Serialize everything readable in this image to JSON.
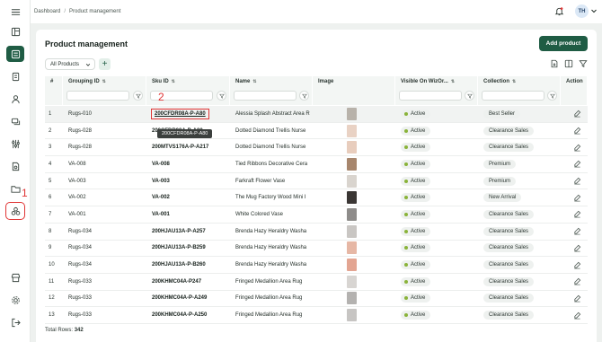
{
  "breadcrumb": {
    "home": "Dashboard",
    "separator": "/",
    "current": "Product management"
  },
  "user": {
    "initials": "TH"
  },
  "page": {
    "title": "Product management",
    "add_label": "Add product"
  },
  "filters": {
    "collection_selector": "All Products",
    "add_symbol": "+"
  },
  "columns": {
    "num": "#",
    "grouping": "Grouping ID",
    "sku": "Sku ID",
    "name": "Name",
    "image": "Image",
    "visible": "Visible On WizOr...",
    "collection": "Collection",
    "action": "Action"
  },
  "rows": [
    {
      "num": "1",
      "grouping": "Rugs-010",
      "sku": "200CFDR08A-P-A80",
      "name": "Alessia Splash Abstract Area R",
      "status": "Active",
      "collection": "Best Seller",
      "thumb": "#b8b2aa"
    },
    {
      "num": "2",
      "grouping": "Rugs-028",
      "sku": "200CFDR08A-P-A80",
      "name": "Dotted Diamond Trellis Nurse",
      "status": "Active",
      "collection": "Clearance Sales",
      "thumb": "#e9d2c4"
    },
    {
      "num": "3",
      "grouping": "Rugs-028",
      "sku": "200MTVS176A-P-A217",
      "name": "Dotted Diamond Trellis Nurse",
      "status": "Active",
      "collection": "Clearance Sales",
      "thumb": "#e8cdbd"
    },
    {
      "num": "4",
      "grouping": "VA-008",
      "sku": "VA-008",
      "name": "Tied Ribbons Decorative Cera",
      "status": "Active",
      "collection": "Premium",
      "thumb": "#a7866d"
    },
    {
      "num": "5",
      "grouping": "VA-003",
      "sku": "VA-003",
      "name": "Farkraft Flower Vase",
      "status": "Active",
      "collection": "Premium",
      "thumb": "#d9d4ce"
    },
    {
      "num": "6",
      "grouping": "VA-002",
      "sku": "VA-002",
      "name": "The Mug Factory Wood Mini I",
      "status": "Active",
      "collection": "New Arrival",
      "thumb": "#3a3634"
    },
    {
      "num": "7",
      "grouping": "VA-001",
      "sku": "VA-001",
      "name": "White Colored Vase",
      "status": "Active",
      "collection": "Clearance Sales",
      "thumb": "#8e8c8a"
    },
    {
      "num": "8",
      "grouping": "Rugs-034",
      "sku": "200HJAU13A-P-A257",
      "name": "Brenda Hazy Heraldry Washa",
      "status": "Active",
      "collection": "Clearance Sales",
      "thumb": "#c9c6c3"
    },
    {
      "num": "9",
      "grouping": "Rugs-034",
      "sku": "200HJAU13A-P-B259",
      "name": "Brenda Hazy Heraldry Washa",
      "status": "Active",
      "collection": "Clearance Sales",
      "thumb": "#e6b7a5"
    },
    {
      "num": "10",
      "grouping": "Rugs-034",
      "sku": "200HJAU13A-P-B260",
      "name": "Brenda Hazy Heraldry Washa",
      "status": "Active",
      "collection": "Clearance Sales",
      "thumb": "#e3a592"
    },
    {
      "num": "11",
      "grouping": "Rugs-033",
      "sku": "200KHMC04A-P247",
      "name": "Fringed Medallion Area Rug",
      "status": "Active",
      "collection": "Clearance Sales",
      "thumb": "#d8d5d2"
    },
    {
      "num": "12",
      "grouping": "Rugs-033",
      "sku": "200KHMC04A-P-A249",
      "name": "Fringed Medallion Area Rug",
      "status": "Active",
      "collection": "Clearance Sales",
      "thumb": "#b4b2b0"
    },
    {
      "num": "13",
      "grouping": "Rugs-033",
      "sku": "200KHMC04A-P-A250",
      "name": "Fringed Medallion Area Rug",
      "status": "Active",
      "collection": "Clearance Sales",
      "thumb": "#c7c5c3"
    }
  ],
  "tooltip": "200CFDR08A-P-A80",
  "annotations": {
    "sidebar_marker": "1",
    "sku_marker": "2"
  },
  "footer": {
    "label": "Total Rows:",
    "count": "342"
  },
  "colors": {
    "brand": "#1f5c44",
    "active_dot": "#8ab33a",
    "annotation": "#e03434"
  }
}
